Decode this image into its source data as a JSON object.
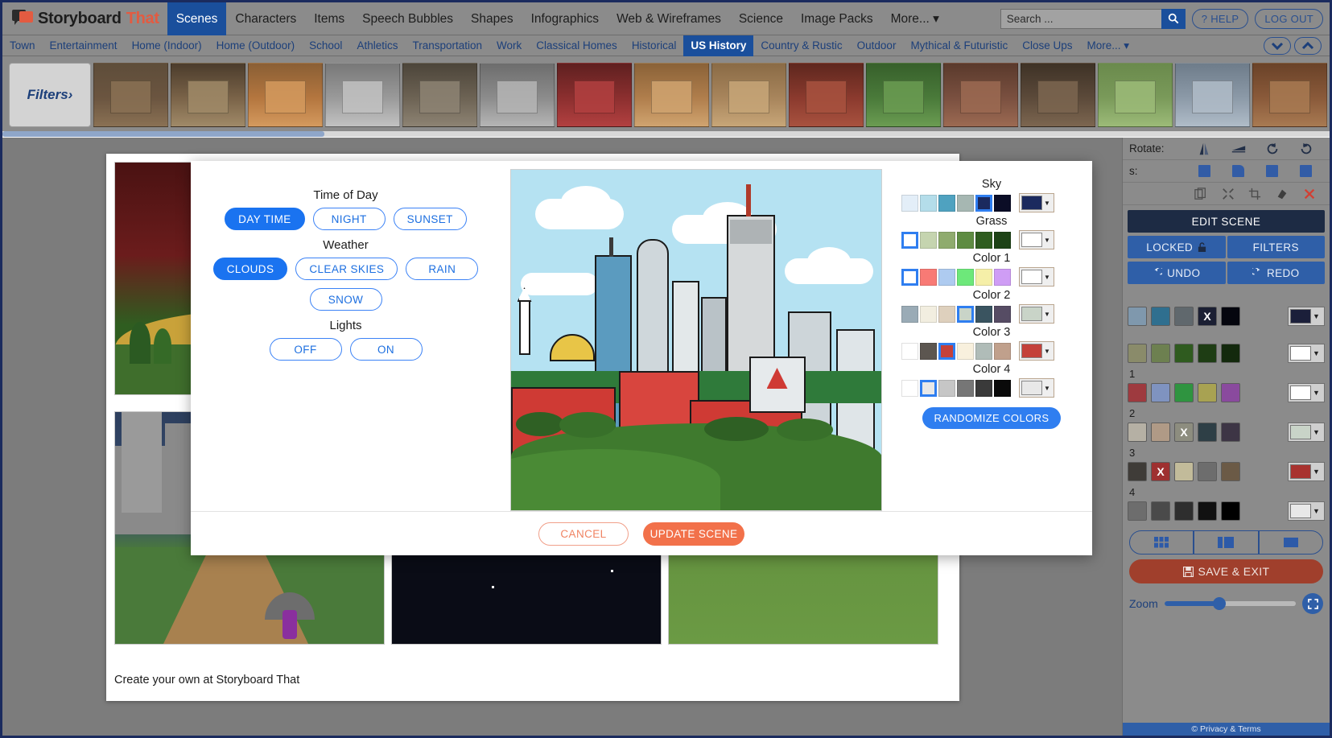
{
  "header": {
    "brand_story": "Storyboard",
    "brand_that": "That",
    "nav": [
      {
        "label": "Scenes",
        "active": true
      },
      {
        "label": "Characters",
        "active": false
      },
      {
        "label": "Items",
        "active": false
      },
      {
        "label": "Speech Bubbles",
        "active": false
      },
      {
        "label": "Shapes",
        "active": false
      },
      {
        "label": "Infographics",
        "active": false
      },
      {
        "label": "Web & Wireframes",
        "active": false
      },
      {
        "label": "Science",
        "active": false
      },
      {
        "label": "Image Packs",
        "active": false
      },
      {
        "label": "More... ▾",
        "active": false
      }
    ],
    "search_placeholder": "Search ...",
    "search_value": "",
    "search_icon": "search-icon",
    "help_label": "? HELP",
    "logout_label": "LOG OUT"
  },
  "subnav": {
    "items": [
      {
        "label": "Town",
        "active": false
      },
      {
        "label": "Entertainment",
        "active": false
      },
      {
        "label": "Home (Indoor)",
        "active": false
      },
      {
        "label": "Home (Outdoor)",
        "active": false
      },
      {
        "label": "School",
        "active": false
      },
      {
        "label": "Athletics",
        "active": false
      },
      {
        "label": "Transportation",
        "active": false
      },
      {
        "label": "Work",
        "active": false
      },
      {
        "label": "Classical Homes",
        "active": false
      },
      {
        "label": "Historical",
        "active": false
      },
      {
        "label": "US History",
        "active": true
      },
      {
        "label": "Country & Rustic",
        "active": false
      },
      {
        "label": "Outdoor",
        "active": false
      },
      {
        "label": "Mythical & Futuristic",
        "active": false
      },
      {
        "label": "Close Ups",
        "active": false
      },
      {
        "label": "More... ▾",
        "active": false
      }
    ]
  },
  "scene_strip": {
    "filters_label": "Filters›",
    "thumbs": [
      {
        "name": "hut-scene",
        "c1": "#6b5540",
        "c2": "#8a7154",
        "sky": "#5e4d3a"
      },
      {
        "name": "log-cabin-scene",
        "c1": "#7a6348",
        "c2": "#a08a68",
        "sky": "#4b3c2c"
      },
      {
        "name": "adobe-building-scene",
        "c1": "#b4763f",
        "c2": "#d49a5e",
        "sky": "#8a5f35"
      },
      {
        "name": "schoolhouse-scene",
        "c1": "#9a9a9a",
        "c2": "#c2c2c2",
        "sky": "#787878"
      },
      {
        "name": "interior-room-scene",
        "c1": "#6d6354",
        "c2": "#8d8373",
        "sky": "#4c453a"
      },
      {
        "name": "capitol-street-scene",
        "c1": "#8c8c8c",
        "c2": "#b5b5b5",
        "sky": "#6d6d6d"
      },
      {
        "name": "theater-stage-scene",
        "c1": "#8c2f2f",
        "c2": "#b24040",
        "sky": "#5f2020"
      },
      {
        "name": "western-town-scene",
        "c1": "#b07e4c",
        "c2": "#d0a470",
        "sky": "#8a6238"
      },
      {
        "name": "desert-scene",
        "c1": "#a8855c",
        "c2": "#c7a678",
        "sky": "#8a6b46"
      },
      {
        "name": "brick-factory-scene",
        "c1": "#8b3a2e",
        "c2": "#a8523f",
        "sky": "#5e271e"
      },
      {
        "name": "city-green-scene",
        "c1": "#4a7a3a",
        "c2": "#6b9c52",
        "sky": "#37602b"
      },
      {
        "name": "parade-scene",
        "c1": "#7a5040",
        "c2": "#9c6a52",
        "sky": "#5a3a2c"
      },
      {
        "name": "projector-room-scene",
        "c1": "#5c4a3a",
        "c2": "#7c6650",
        "sky": "#3e3226"
      },
      {
        "name": "white-house-scene",
        "c1": "#7a9a5a",
        "c2": "#9cbb78",
        "sky": "#6a8a4c"
      },
      {
        "name": "capitol-dome-scene",
        "c1": "#8c9aa8",
        "c2": "#b0bcc8",
        "sky": "#6e7c8a"
      },
      {
        "name": "courtroom-scene",
        "c1": "#8a5a3a",
        "c2": "#a87a52",
        "sky": "#6a4228"
      }
    ]
  },
  "storyboard": {
    "footer_text": "Create your own at Storyboard That",
    "cells": [
      {
        "name": "cell-red-room"
      },
      {
        "name": "cell-hidden-1"
      },
      {
        "name": "cell-hidden-2"
      },
      {
        "name": "cell-castle-rain"
      },
      {
        "name": "cell-space-planet"
      },
      {
        "name": "cell-candyland"
      }
    ]
  },
  "right_panel": {
    "rotate_label": "Rotate:",
    "effects_label": "s:",
    "rotate_icons": [
      "flip-horizontal-icon",
      "flip-vertical-icon",
      "rotate-left-icon",
      "rotate-right-icon"
    ],
    "effect_icons": [
      "filter-1-icon",
      "filter-2-icon",
      "filter-3-icon",
      "filter-4-icon"
    ],
    "tool_icons": [
      "duplicate-icon",
      "resize-icon",
      "crop-icon",
      "eraser-icon",
      "delete-icon"
    ],
    "edit_scene_label": "EDIT SCENE",
    "locked_label": "LOCKED",
    "lock_icon": "unlock-icon",
    "filters_label": "FILTERS",
    "undo_label": "UNDO",
    "undo_icon": "undo-icon",
    "redo_label": "REDO",
    "redo_icon": "redo-icon",
    "palette_rows": [
      {
        "label": "",
        "swatches": [
          "#7f98ad",
          "#2f6f8f",
          "#60686d",
          "#1b1f33",
          "#05060e"
        ],
        "marked_index": 3,
        "marked_glyph": "X",
        "dropdown": "#1b1f3a"
      },
      {
        "label": "",
        "swatches": [
          "#8a8b6a",
          "#6d8050",
          "#2f5b1f",
          "#1e3d14",
          "#13290d"
        ],
        "marked_index": -1,
        "marked_glyph": "",
        "dropdown": "#ffffff"
      },
      {
        "label": "1",
        "swatches": [
          "#9e3a3f",
          "#7f93c0",
          "#2f9440",
          "#a8a252",
          "#8a4a9e"
        ],
        "marked_index": -1,
        "marked_glyph": "",
        "dropdown": "#ffffff"
      },
      {
        "label": "2",
        "swatches": [
          "#b5b0a4",
          "#b09a86",
          "#8d8d7f",
          "#2e3f46",
          "#3d3545"
        ],
        "marked_index": 2,
        "marked_glyph": "X",
        "dropdown": "#c9d4c8"
      },
      {
        "label": "3",
        "swatches": [
          "#3f3c38",
          "#9e3030",
          "#c2bb9a",
          "#6d6d6d",
          "#6b5a46"
        ],
        "marked_index": 1,
        "marked_glyph": "X",
        "dropdown": "#a8322f"
      },
      {
        "label": "4",
        "swatches": [
          "#6d6d6d",
          "#4a4a4a",
          "#2e2e2e",
          "#111111",
          "#000000"
        ],
        "marked_index": -1,
        "marked_glyph": "X",
        "dropdown": "#e8e8e8"
      }
    ],
    "layout_icons": [
      "grid-layout-icon",
      "columns-layout-icon",
      "single-layout-icon"
    ],
    "save_exit_label": "SAVE & EXIT",
    "save_icon": "floppy-disk-icon",
    "zoom_label": "Zoom",
    "fullscreen_icon": "fullscreen-icon",
    "privacy_label": "© Privacy & Terms"
  },
  "modal": {
    "groups": [
      {
        "title": "Time of Day",
        "name": "time-of-day",
        "options": [
          {
            "label": "DAY TIME",
            "selected": true
          },
          {
            "label": "NIGHT",
            "selected": false
          },
          {
            "label": "SUNSET",
            "selected": false
          }
        ]
      },
      {
        "title": "Weather",
        "name": "weather",
        "options": [
          {
            "label": "CLOUDS",
            "selected": true
          },
          {
            "label": "CLEAR SKIES",
            "selected": false
          },
          {
            "label": "RAIN",
            "selected": false
          },
          {
            "label": "SNOW",
            "selected": false
          }
        ]
      },
      {
        "title": "Lights",
        "name": "lights",
        "options": [
          {
            "label": "OFF",
            "selected": false
          },
          {
            "label": "ON",
            "selected": false
          }
        ]
      }
    ],
    "preview_name": "city-skyline-preview",
    "palettes": [
      {
        "label": "Sky",
        "name": "sky",
        "swatches": [
          "#e3eef8",
          "#b4ddea",
          "#4fa2c0",
          "#a6b7b2",
          "#1b2a5e",
          "#0b0d26"
        ],
        "selected_index": 4,
        "dropdown_color": "#1b2a5e"
      },
      {
        "label": "Grass",
        "name": "grass",
        "swatches": [
          "#ffffff",
          "#c5d4af",
          "#8fab6e",
          "#5e8c42",
          "#2f5d20",
          "#1d4316"
        ],
        "selected_index": 0,
        "dropdown_color": "#ffffff"
      },
      {
        "label": "Color 1",
        "name": "color-1",
        "swatches": [
          "#ffffff",
          "#f87a75",
          "#aecbf0",
          "#6de87a",
          "#f5efa8",
          "#cf9df5"
        ],
        "selected_index": 0,
        "dropdown_color": "#ffffff"
      },
      {
        "label": "Color 2",
        "name": "color-2",
        "swatches": [
          "#9aabb6",
          "#f2eee0",
          "#ded0bd",
          "#c9d4c8",
          "#3a5460",
          "#564c64"
        ],
        "selected_index": 3,
        "dropdown_color": "#c9d4c8"
      },
      {
        "label": "Color 3",
        "name": "color-3",
        "swatches": [
          "#ffffff",
          "#5c5650",
          "#c4413a",
          "#f8f0dd",
          "#b0bcb8",
          "#c0a08c"
        ],
        "selected_index": 2,
        "dropdown_color": "#c4413a"
      },
      {
        "label": "Color 4",
        "name": "color-4",
        "swatches": [
          "#ffffff",
          "#e8e8e8",
          "#c6c6c6",
          "#767676",
          "#3a3a3a",
          "#0a0a0a"
        ],
        "selected_index": 1,
        "dropdown_color": "#e8e8e8"
      }
    ],
    "randomize_label": "RANDOMIZE COLORS",
    "cancel_label": "CANCEL",
    "update_label": "UPDATE SCENE"
  },
  "colors": {
    "accent_blue": "#1a73f0",
    "nav_active": "#1a4f9c",
    "brand_orange": "#e35b41",
    "update_orange": "#f2714a",
    "panel_gray": "#8b8b8b",
    "canvas_gray": "#7c7c7c",
    "dark_navy": "#1d2b44"
  }
}
